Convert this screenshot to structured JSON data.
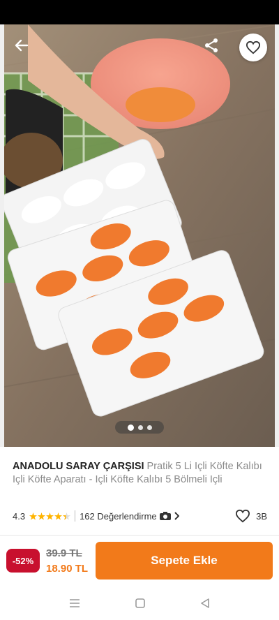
{
  "product": {
    "brand": "ANADOLU SARAY ÇARŞISI",
    "name": " Pratik 5 Li Içli Köfte Kalıbı Içli Köfte Aparatı - Içli Köfte Kalıbı 5 Bölmeli Içli",
    "rating": "4.3",
    "rating_stars": 4.3,
    "reviews_label": "162 Değerlendirme",
    "likes": "3B"
  },
  "gallery": {
    "total_images": 3,
    "active_index": 0
  },
  "price": {
    "discount": "-52%",
    "old_price": "39.9 TL",
    "new_price": "18.90 TL"
  },
  "actions": {
    "add_to_cart": "Sepete Ekle"
  },
  "icons": {
    "back": "back-arrow-icon",
    "share": "share-icon",
    "favorite": "heart-icon",
    "camera": "camera-icon",
    "chevron": "chevron-right-icon"
  },
  "colors": {
    "accent": "#f27a1a",
    "discount": "#c8102e"
  }
}
